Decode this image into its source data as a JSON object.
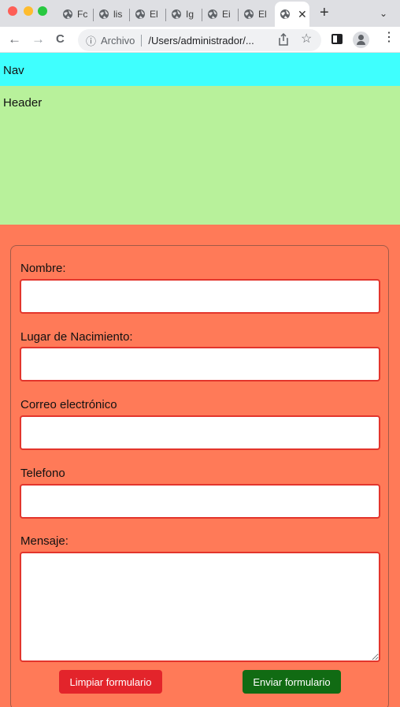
{
  "browser": {
    "tabs": [
      {
        "label": "Fc"
      },
      {
        "label": "lis"
      },
      {
        "label": "El"
      },
      {
        "label": "Ig"
      },
      {
        "label": "Ei"
      },
      {
        "label": "El"
      },
      {
        "label": ""
      }
    ],
    "active_tab_close": "✕",
    "new_tab": "+",
    "tab_menu": "⌄",
    "toolbar": {
      "back": "←",
      "forward": "→",
      "reload": "C",
      "star": "☆",
      "menu": "⋮"
    },
    "address": {
      "scheme_label": "Archivo",
      "path": "/Users/administrador/..."
    }
  },
  "page": {
    "nav_text": "Nav",
    "header_text": "Header",
    "form": {
      "fields": [
        {
          "label": "Nombre:",
          "value": ""
        },
        {
          "label": "Lugar de Nacimiento:",
          "value": ""
        },
        {
          "label": "Correo electrónico",
          "value": ""
        },
        {
          "label": "Telefono",
          "value": ""
        }
      ],
      "message": {
        "label": "Mensaje:",
        "value": ""
      },
      "buttons": {
        "clear": "Limpiar formulario",
        "send": "Enviar formulario"
      }
    }
  },
  "colors": {
    "nav_bg": "#3ffffe",
    "header_bg": "#b8f19b",
    "main_bg": "#ff7a58",
    "field_border": "#e3352c",
    "clear_button": "#e3242b",
    "send_button": "#116b13"
  }
}
